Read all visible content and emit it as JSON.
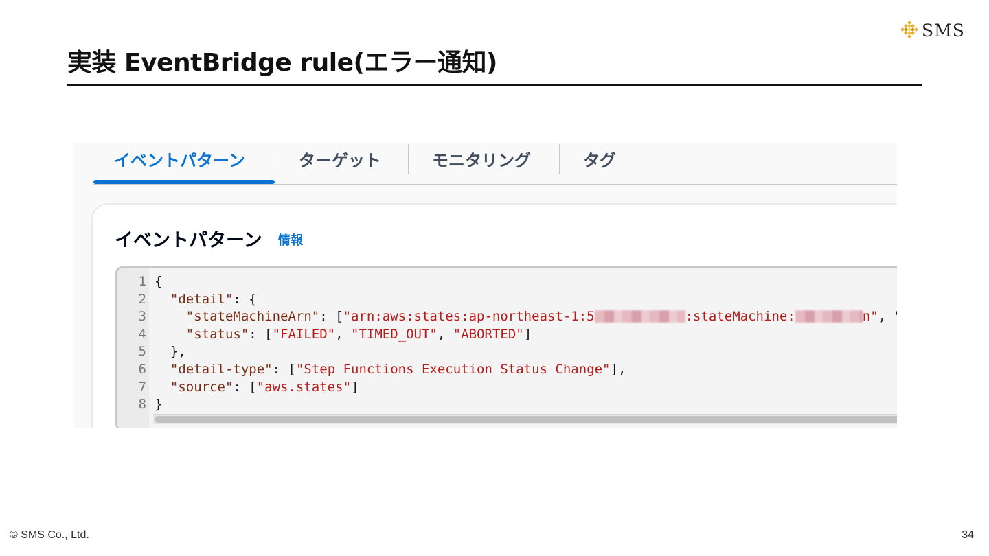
{
  "slide": {
    "title": "実装 EventBridge rule(エラー通知)",
    "page_number": "34",
    "copyright": "© SMS Co., Ltd."
  },
  "logo": {
    "text": "SMS",
    "icon": "diamond-mosaic-logo",
    "color": "#e3a92a"
  },
  "console": {
    "tabs": [
      {
        "label": "イベントパターン",
        "active": true
      },
      {
        "label": "ターゲット",
        "active": false
      },
      {
        "label": "モニタリング",
        "active": false
      },
      {
        "label": "タグ",
        "active": false
      }
    ],
    "panel_title": "イベントパターン",
    "info_link": "情報",
    "accent_color": "#0972d3",
    "editor": {
      "line_numbers": [
        "1",
        "2",
        "3",
        "4",
        "5",
        "6",
        "7",
        "8"
      ],
      "lines": [
        {
          "open": "{"
        },
        {
          "key": "\"detail\"",
          "rest": ": {"
        },
        {
          "key": "\"stateMachineArn\"",
          "p1": ": [",
          "s1": "\"arn:aws:states:ap-northeast-1:5",
          "s2": ":stateMachine:",
          "s3": "n\"",
          "p2": ", \""
        },
        {
          "key": "\"status\"",
          "p1": ": [",
          "v1": "\"FAILED\"",
          "v2": "\"TIMED_OUT\"",
          "v3": "\"ABORTED\"",
          "p2": "]"
        },
        {
          "close": "},"
        },
        {
          "key": "\"detail-type\"",
          "p1": ": [",
          "v1": "\"Step Functions Execution Status Change\"",
          "p2": "],"
        },
        {
          "key": "\"source\"",
          "p1": ": [",
          "v1": "\"aws.states\"",
          "p2": "]"
        },
        {
          "close": "}"
        }
      ],
      "comma": ", "
    }
  }
}
